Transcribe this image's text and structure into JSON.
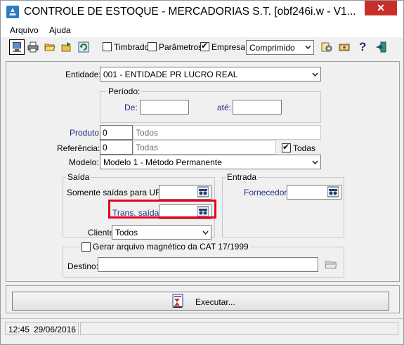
{
  "window": {
    "title": "CONTROLE DE ESTOQUE - MERCADORIAS S.T. [obf246i.w - V1...",
    "close_glyph": "✕"
  },
  "menu": {
    "items": [
      "Arquivo",
      "Ajuda"
    ]
  },
  "toolbar": {
    "icons": [
      "monitor-icon",
      "printer-icon",
      "open-folder-icon",
      "export-folder-icon",
      "refresh-icon"
    ],
    "timbrado_label": "Timbrado",
    "timbrado_checked": false,
    "parametros_label": "Parâmetros",
    "parametros_checked": false,
    "empresa_label": "Empresa",
    "empresa_checked": true,
    "format_value": "Comprimido",
    "right_icons": [
      "settings-icon",
      "cash-icon",
      "help-icon",
      "exit-icon"
    ],
    "help_glyph": "?"
  },
  "form": {
    "entidade_label": "Entidade:",
    "entidade_value": "001 - ENTIDADE PR LUCRO REAL",
    "periodo": {
      "title": "Período:",
      "de_label": "De:",
      "de_value": "",
      "ate_label": "até:",
      "ate_value": ""
    },
    "produto_label": "Produto:",
    "produto_code": "0",
    "produto_desc": "Todos",
    "referencia_label": "Referência:",
    "referencia_code": "0",
    "referencia_desc": "Todas",
    "todas_label": "Todas",
    "todas_checked": true,
    "modelo_label": "Modelo:",
    "modelo_value": "Modelo 1 - Método Permanente",
    "saida": {
      "title": "Saída",
      "uf_label": "Somente saídas para UF:",
      "uf_value": "",
      "trans_label": "Trans. saída:",
      "trans_value": "",
      "cliente_label": "Cliente:",
      "cliente_value": "Todos"
    },
    "entrada": {
      "title": "Entrada",
      "fornecedor_label": "Fornecedor:",
      "fornecedor_value": ""
    },
    "cat": {
      "title": "Gerar arquivo magnético da CAT 17/1999",
      "checked": false,
      "destino_label": "Destino:",
      "destino_value": ""
    }
  },
  "actions": {
    "executar_label": "Executar..."
  },
  "status": {
    "time": "12:45",
    "date": "29/06/2016"
  },
  "colors": {
    "label_blue": "#1f2e8c",
    "highlight": "#e8001f",
    "close_red": "#c7302a"
  }
}
